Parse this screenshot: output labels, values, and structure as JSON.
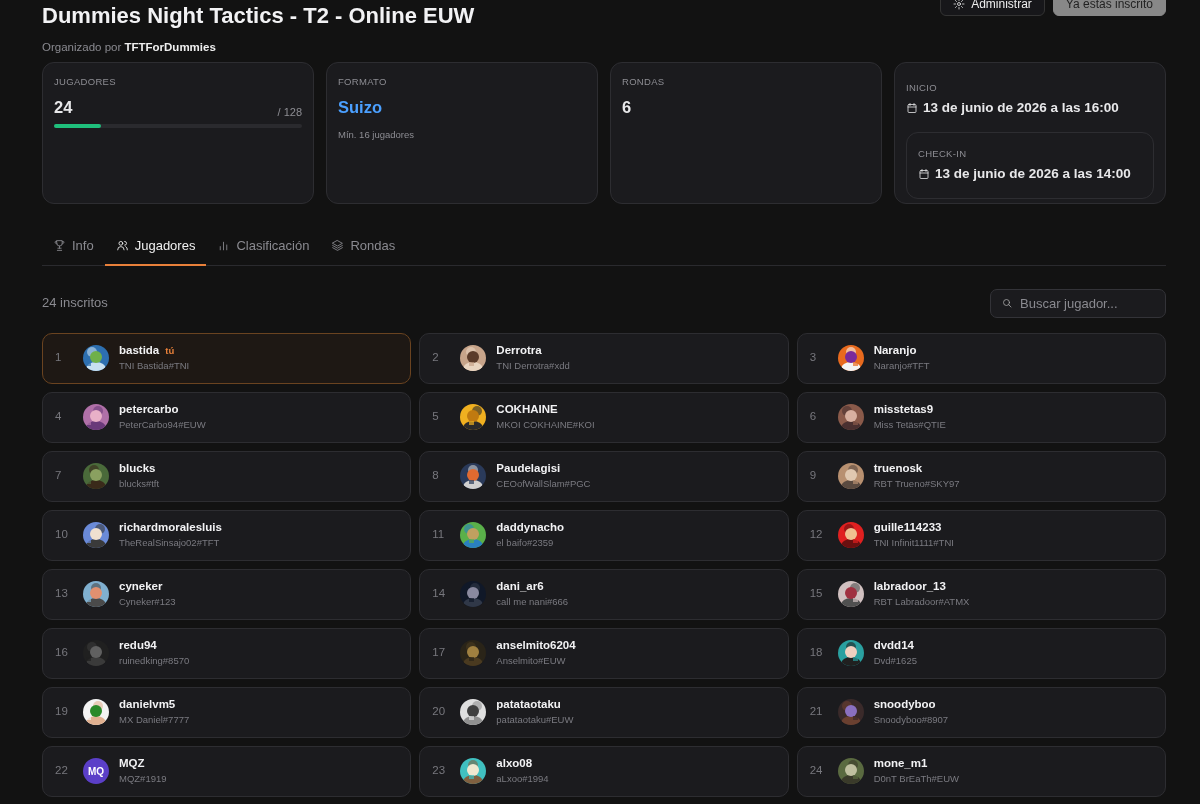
{
  "header": {
    "title": "Dummies Night Tactics - T2 - Online EUW",
    "organizer_label": "Organizado por",
    "organizer": "TFTForDummies",
    "actions": [
      {
        "kind": "admin",
        "label": "Administrar"
      },
      {
        "kind": "status",
        "label": "Ya estás inscrito"
      }
    ]
  },
  "stats": [
    {
      "kind": "players",
      "label": "JUGADORES",
      "value": "24",
      "max": "/ 128",
      "level": 0.1875
    },
    {
      "kind": "format",
      "label": "FORMATO",
      "value": "Suizo",
      "note": "Mín. 16 jugadores"
    },
    {
      "kind": "rounds",
      "label": "RONDAS",
      "value": "6"
    },
    {
      "kind": "dates",
      "label": "INICIO",
      "value": "13 de junio de 2026 a las 16:00",
      "sub_label": "CHECK-IN",
      "sub_value": "13 de junio de 2026 a las 14:00"
    }
  ],
  "tabs": [
    {
      "label": "Info",
      "selected": false
    },
    {
      "label": "Jugadores",
      "selected": true
    },
    {
      "label": "Clasificación",
      "selected": false
    },
    {
      "label": "Rondas",
      "selected": false
    }
  ],
  "count": "24 inscritos",
  "search": {
    "placeholder": "Buscar jugador..."
  },
  "players": [
    {
      "rank": "1",
      "name": "bastida",
      "badge": "tú",
      "tag": "TNI Bastida#TNI",
      "selected": true
    },
    {
      "rank": "2",
      "name": "Derrotra",
      "tag": "TNI Derrotra#xdd",
      "selected": false
    },
    {
      "rank": "3",
      "name": "Naranjo",
      "tag": "Naranjo#TFT",
      "selected": false
    },
    {
      "rank": "4",
      "name": "petercarbo",
      "tag": "PeterCarbo94#EUW",
      "selected": false
    },
    {
      "rank": "5",
      "name": "COKHAINE",
      "tag": "MKOI COKHAINE#KOI",
      "selected": false
    },
    {
      "rank": "6",
      "name": "misstetas9",
      "tag": "Miss Tetäs#QTIE",
      "selected": false
    },
    {
      "rank": "7",
      "name": "blucks",
      "tag": "blucks#tft",
      "selected": false
    },
    {
      "rank": "8",
      "name": "Paudelagisi",
      "tag": "CEOofWallSlam#PGC",
      "selected": false
    },
    {
      "rank": "9",
      "name": "truenosk",
      "tag": "RBT Trueno#SKY97",
      "selected": false
    },
    {
      "rank": "10",
      "name": "richardmoralesluis",
      "tag": "TheRealSinsajo02#TFT",
      "selected": false
    },
    {
      "rank": "11",
      "name": "daddynacho",
      "tag": "el baifo#2359",
      "selected": false
    },
    {
      "rank": "12",
      "name": "guille114233",
      "tag": "TNI Infinit1111#TNI",
      "selected": false
    },
    {
      "rank": "13",
      "name": "cyneker",
      "tag": "Cyneker#123",
      "selected": false
    },
    {
      "rank": "14",
      "name": "dani_ar6",
      "tag": "call me nani#666",
      "selected": false
    },
    {
      "rank": "15",
      "name": "labradoor_13",
      "tag": "RBT Labradoor#ATMX",
      "selected": false
    },
    {
      "rank": "16",
      "name": "redu94",
      "tag": "ruinedking#8570",
      "selected": false
    },
    {
      "rank": "17",
      "name": "anselmito6204",
      "tag": "Anselmito#EUW",
      "selected": false
    },
    {
      "rank": "18",
      "name": "dvdd14",
      "tag": "Dvd#1625",
      "selected": false
    },
    {
      "rank": "19",
      "name": "danielvm5",
      "tag": "MX Daniel#7777",
      "selected": false
    },
    {
      "rank": "20",
      "name": "patataotaku",
      "tag": "patataotaku#EUW",
      "selected": false
    },
    {
      "rank": "21",
      "name": "snoodyboo",
      "tag": "Snoodyboo#8907",
      "selected": false
    },
    {
      "rank": "22",
      "name": "MQZ",
      "tag": "MQZ#1919",
      "selected": false,
      "avatar": {
        "kind": "initials",
        "text": "MQ",
        "color": "#5b3fc8"
      }
    },
    {
      "rank": "23",
      "name": "alxo08",
      "tag": "aLxoo#1994",
      "selected": false
    },
    {
      "rank": "24",
      "name": "mone_m1",
      "tag": "D0nT BrEaTh#EUW",
      "selected": false
    }
  ]
}
